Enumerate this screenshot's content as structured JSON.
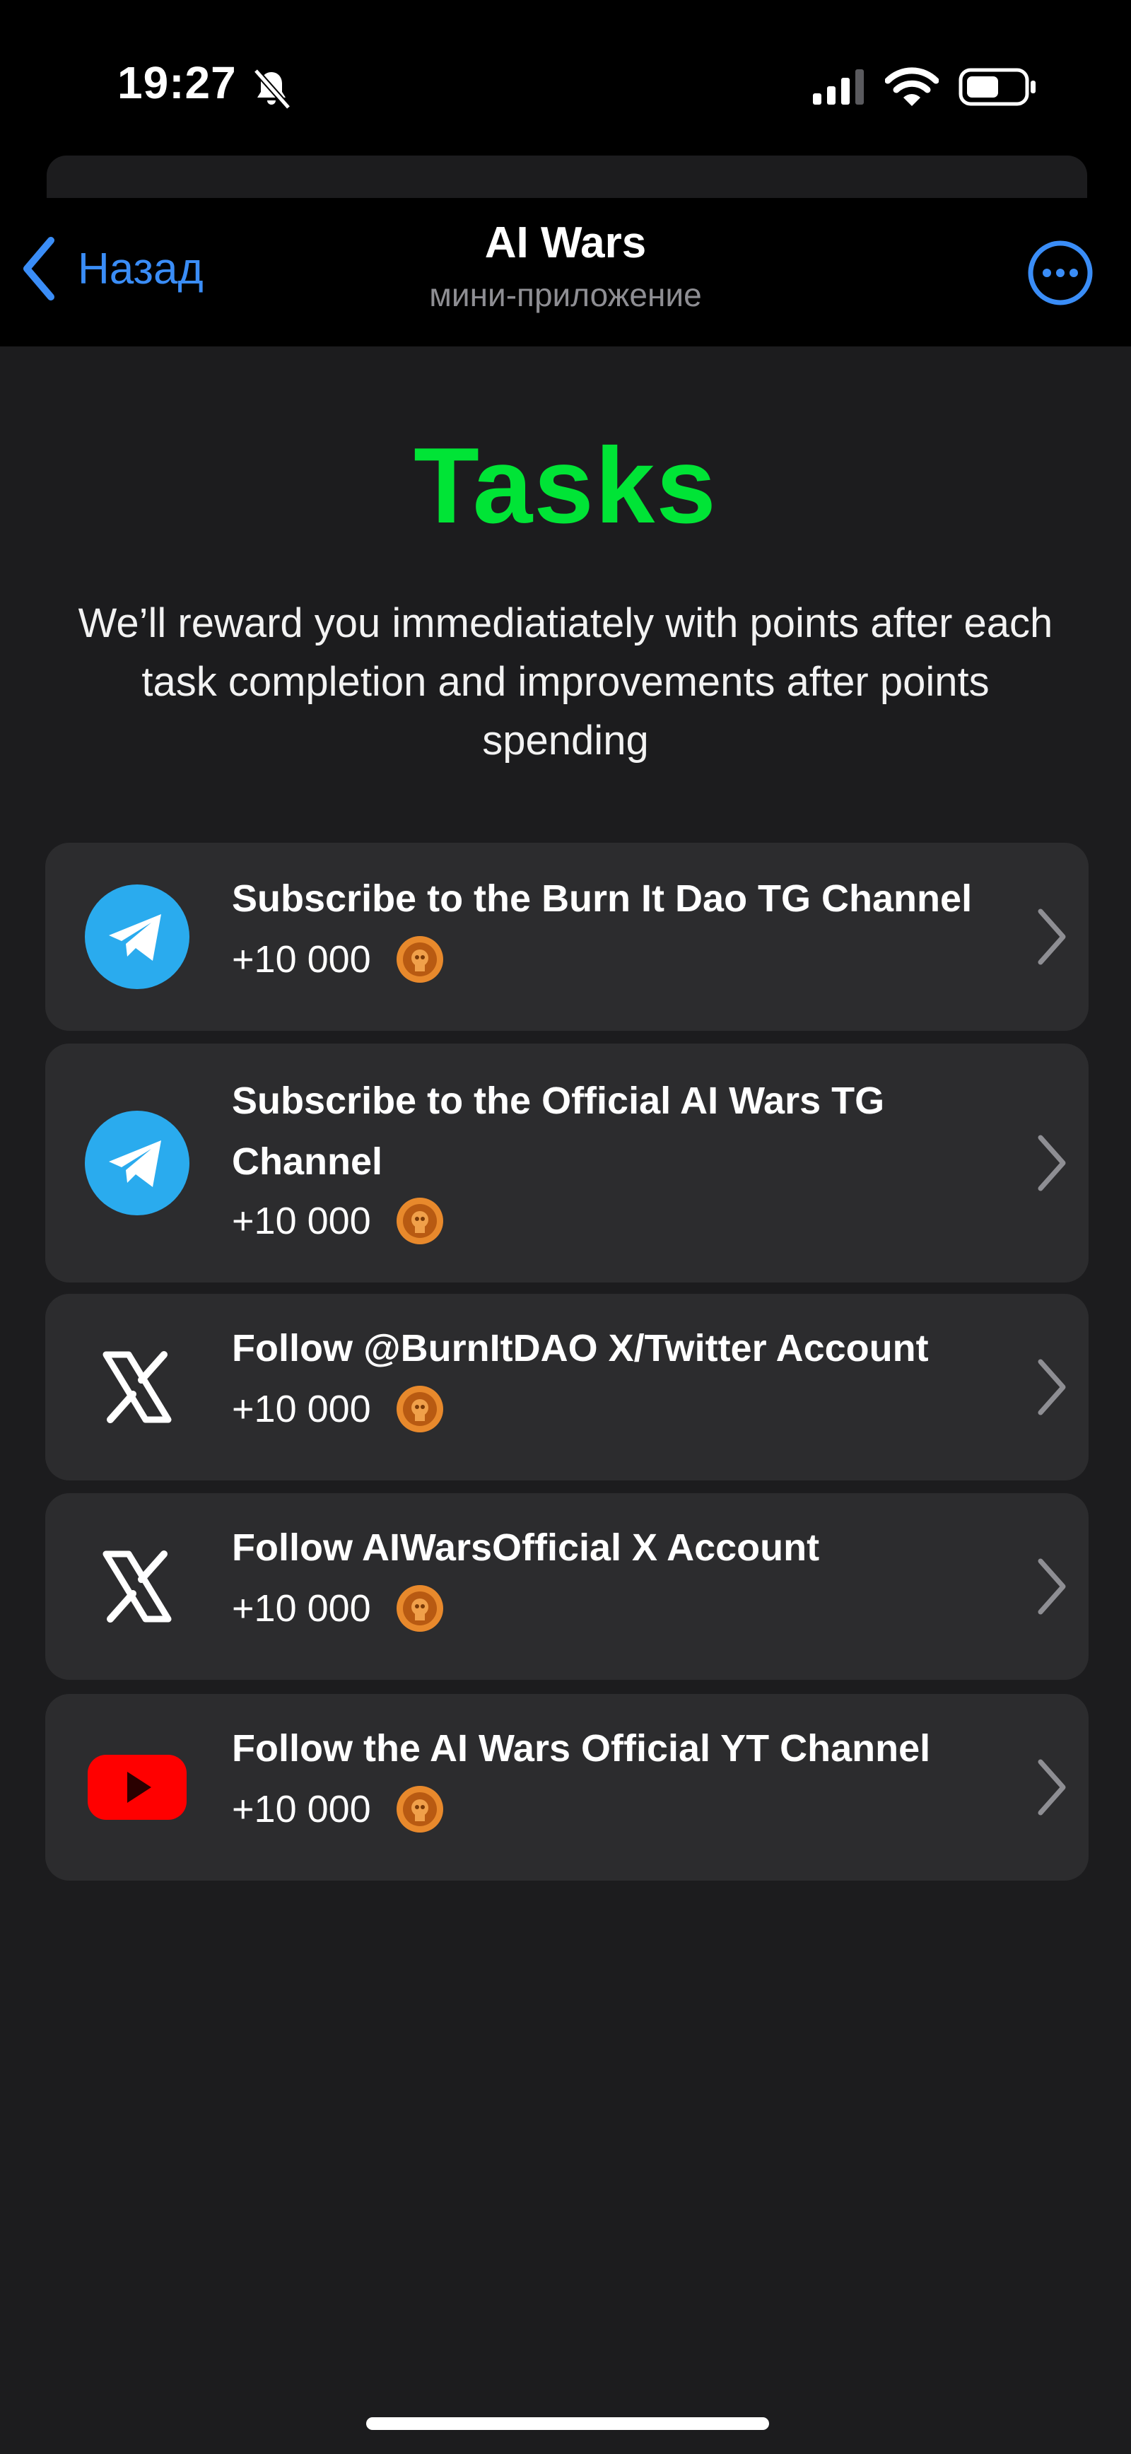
{
  "status_bar": {
    "time": "19:27"
  },
  "header": {
    "back_label": "Назад",
    "title": "AI Wars",
    "subtitle": "мини-приложение"
  },
  "page": {
    "title": "Tasks",
    "description": "We’ll reward you immediatiately with points after each task completion and improvements after points spending"
  },
  "tasks": [
    {
      "icon": "telegram-icon",
      "title": "Subscribe to the Burn It Dao TG Channel",
      "reward": "+10 000"
    },
    {
      "icon": "telegram-icon",
      "title": "Subscribe to the Official AI Wars TG Channel",
      "reward": "+10 000"
    },
    {
      "icon": "x-twitter-icon",
      "title": "Follow @BurnItDAO X/Twitter Account",
      "reward": "+10 000"
    },
    {
      "icon": "x-twitter-icon",
      "title": "Follow AIWarsOfficial X Account",
      "reward": "+10 000"
    },
    {
      "icon": "youtube-icon",
      "title": "Follow the AI Wars Official YT Channel",
      "reward": "+10 000"
    }
  ],
  "colors": {
    "background": "#1c1c1e",
    "card": "#2c2c2e",
    "accent_green": "#00e436",
    "link_blue": "#3a8df7",
    "telegram_blue": "#2aabee",
    "youtube_red": "#ff0000",
    "coin_orange": "#e8892c"
  }
}
